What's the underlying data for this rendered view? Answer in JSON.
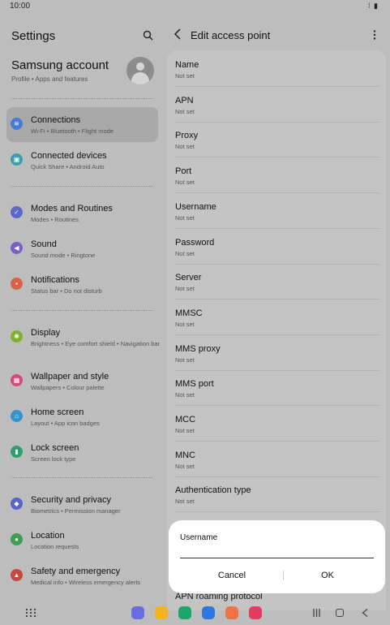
{
  "status_bar": {
    "time": "10:00",
    "icons_text": "⁞ ▮"
  },
  "left": {
    "title": "Settings",
    "account": {
      "name": "Samsung account",
      "sub": "Profile  •  Apps and features"
    },
    "items": [
      {
        "label": "Connections",
        "sub": "Wi-Fi  •  Bluetooth  •  Flight mode",
        "icon": "wifi-icon",
        "color": "#4a7bd6",
        "glyph": "≋"
      },
      {
        "label": "Connected devices",
        "sub": "Quick Share  •  Android Auto",
        "icon": "devices-icon",
        "color": "#3aa0a8",
        "glyph": "▣"
      },
      {
        "label": "Modes and Routines",
        "sub": "Modes  •  Routines",
        "icon": "modes-icon",
        "color": "#5b68c9",
        "glyph": "✓"
      },
      {
        "label": "Sound",
        "sub": "Sound mode  •  Ringtone",
        "icon": "sound-icon",
        "color": "#7b5fc9",
        "glyph": "◀"
      },
      {
        "label": "Notifications",
        "sub": "Status bar  •  Do not disturb",
        "icon": "notifications-icon",
        "color": "#d8614e",
        "glyph": "▪"
      },
      {
        "label": "Display",
        "sub": "Brightness  •  Eye comfort shield  •  Navigation bar",
        "icon": "display-icon",
        "color": "#7fb12f",
        "glyph": "✺"
      },
      {
        "label": "Wallpaper and style",
        "sub": "Wallpapers  •  Colour palette",
        "icon": "wallpaper-icon",
        "color": "#d1487d",
        "glyph": "▦"
      },
      {
        "label": "Home screen",
        "sub": "Layout  •  App icon badges",
        "icon": "home-icon",
        "color": "#3496c8",
        "glyph": "⌂"
      },
      {
        "label": "Lock screen",
        "sub": "Screen lock type",
        "icon": "lock-icon",
        "color": "#2f9d6e",
        "glyph": "▮"
      },
      {
        "label": "Security and privacy",
        "sub": "Biometrics  •  Permission manager",
        "icon": "shield-icon",
        "color": "#5865c8",
        "glyph": "◆"
      },
      {
        "label": "Location",
        "sub": "Location requests",
        "icon": "location-icon",
        "color": "#3f9e54",
        "glyph": "●"
      },
      {
        "label": "Safety and emergency",
        "sub": "Medical info  •  Wireless emergency alerts",
        "icon": "emergency-icon",
        "color": "#c9473d",
        "glyph": "▲"
      }
    ]
  },
  "right": {
    "title": "Edit access point",
    "fields": [
      {
        "label": "Name",
        "value": "Not set"
      },
      {
        "label": "APN",
        "value": "Not set"
      },
      {
        "label": "Proxy",
        "value": "Not set"
      },
      {
        "label": "Port",
        "value": "Not set"
      },
      {
        "label": "Username",
        "value": "Not set"
      },
      {
        "label": "Password",
        "value": "Not set"
      },
      {
        "label": "Server",
        "value": "Not set"
      },
      {
        "label": "MMSC",
        "value": "Not set"
      },
      {
        "label": "MMS proxy",
        "value": "Not set"
      },
      {
        "label": "MMS port",
        "value": "Not set"
      },
      {
        "label": "MCC",
        "value": "Not set"
      },
      {
        "label": "MNC",
        "value": "Not set"
      },
      {
        "label": "Authentication type",
        "value": "Not set"
      }
    ],
    "trailing_field": "APN roaming protocol"
  },
  "dialog": {
    "title": "Username",
    "input_value": "",
    "cancel_label": "Cancel",
    "ok_label": "OK"
  },
  "nav": {
    "dock_apps": [
      {
        "name": "dock-app-messages",
        "color": "#6a6ce0"
      },
      {
        "name": "dock-app-files",
        "color": "#f2b31b"
      },
      {
        "name": "dock-app-phone",
        "color": "#1fa56a"
      },
      {
        "name": "dock-app-chat",
        "color": "#2f77e0"
      },
      {
        "name": "dock-app-bixby",
        "color": "#f07248"
      },
      {
        "name": "dock-app-video",
        "color": "#e23c63"
      }
    ]
  }
}
